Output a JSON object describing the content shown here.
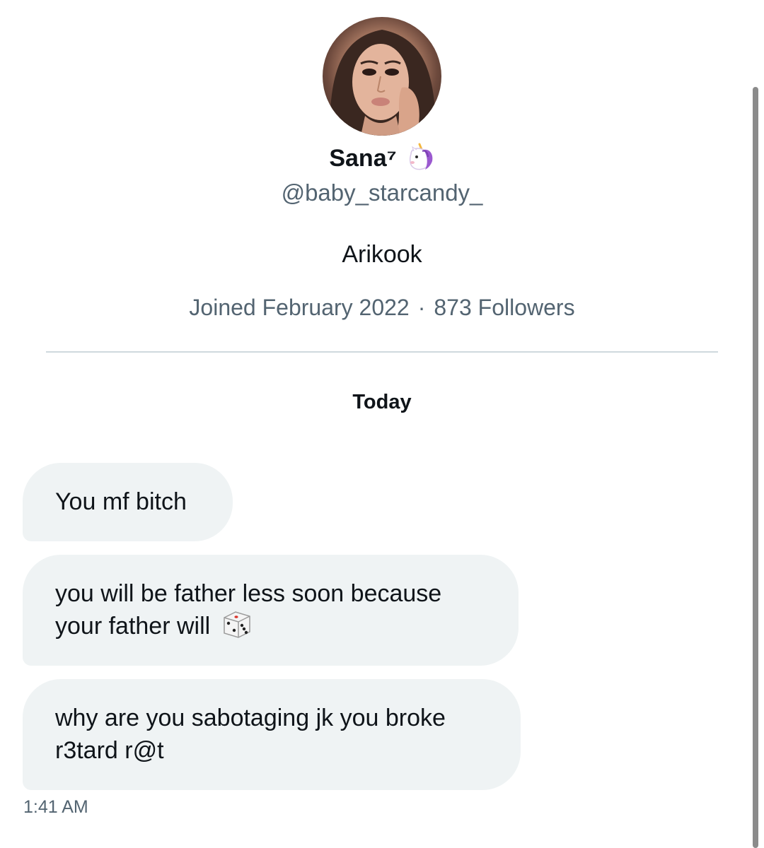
{
  "profile": {
    "avatar_alt": "profile photo",
    "display_name": "Sana⁷",
    "name_emoji": "unicorn-icon",
    "handle": "@baby_starcandy_",
    "bio": "Arikook",
    "joined": "Joined February 2022",
    "separator": "·",
    "followers": "873 Followers"
  },
  "conversation": {
    "date_label": "Today",
    "messages": [
      {
        "text": "You mf bitch"
      },
      {
        "line1": "you will be father less soon because",
        "line2": "your father will",
        "emoji": "dice-icon"
      },
      {
        "line1": "why are you sabotaging jk you broke",
        "line2": "r3tard r@t"
      }
    ],
    "timestamp": "1:41 AM"
  },
  "colors": {
    "bubble_bg": "#eff3f4",
    "secondary_text": "#536471",
    "primary_text": "#0f1419",
    "divider": "#cfd9de"
  }
}
